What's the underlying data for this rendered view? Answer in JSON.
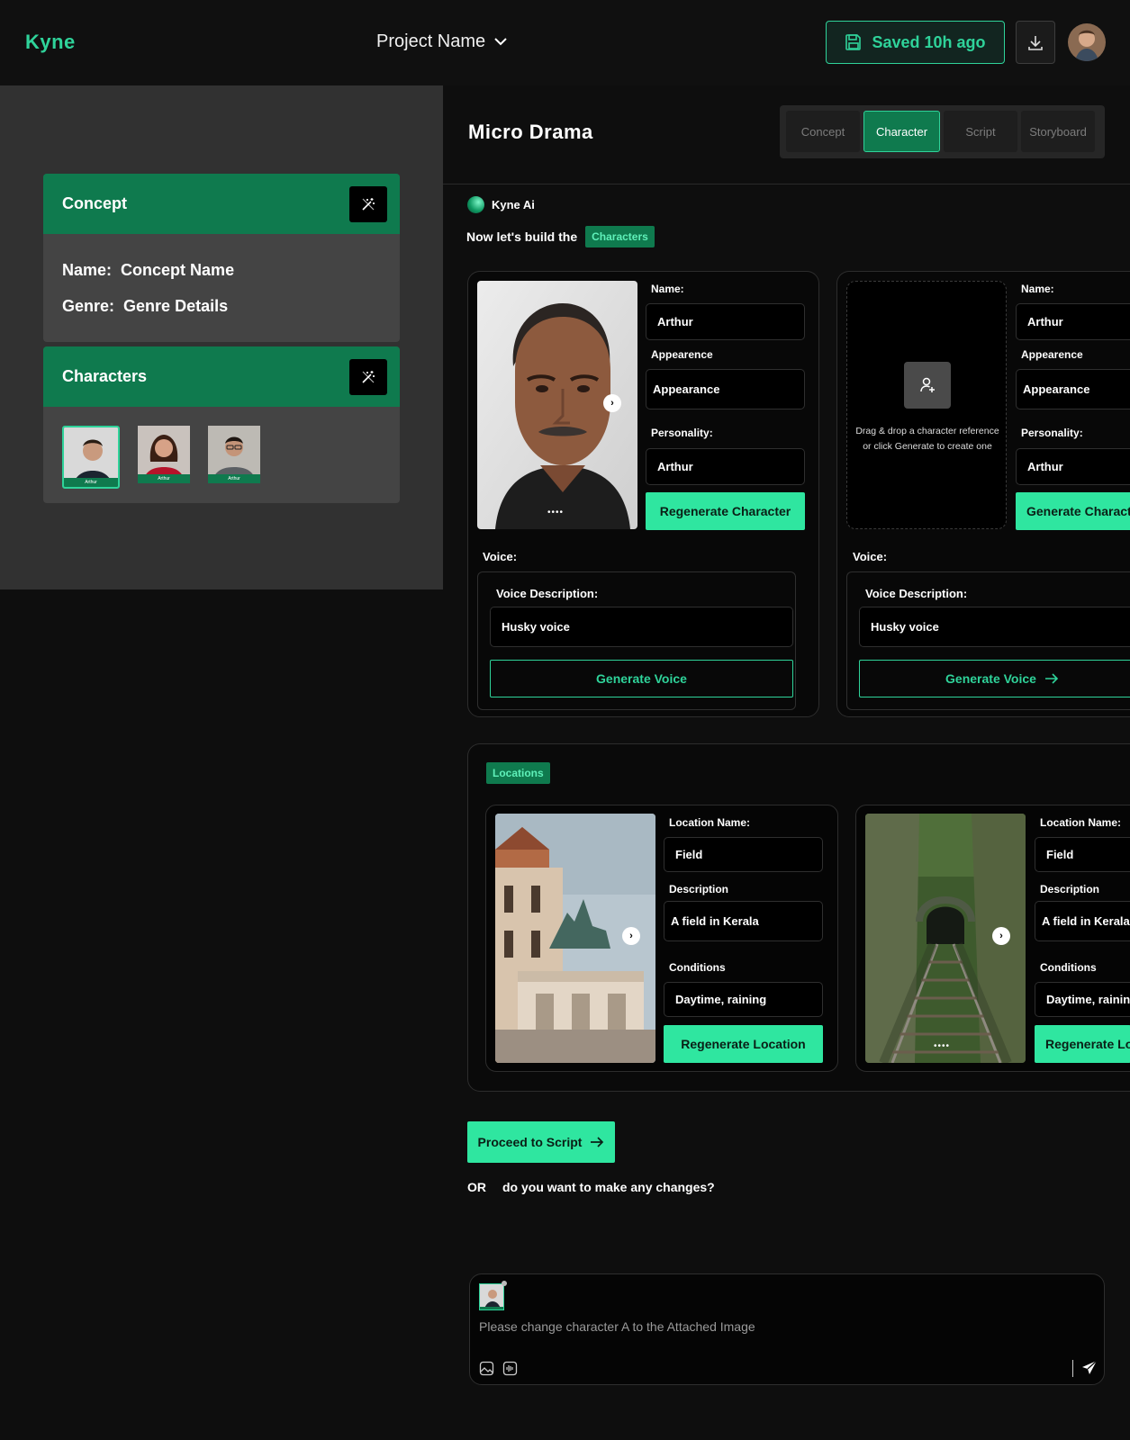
{
  "header": {
    "logo": "Kyne",
    "project_name": "Project Name",
    "saved_status": "Saved 10h ago"
  },
  "sidebar": {
    "concept_card": {
      "title": "Concept",
      "name_label": "Name:",
      "name_value": "Concept Name",
      "genre_label": "Genre:",
      "genre_value": "Genre Details"
    },
    "characters_card": {
      "title": "Characters",
      "thumb_labels": [
        "Arthur",
        "Arthur",
        "Arthur"
      ]
    }
  },
  "main": {
    "title": "Micro Drama",
    "tabs": [
      {
        "label": "Concept",
        "active": false
      },
      {
        "label": "Character",
        "active": true
      },
      {
        "label": "Script",
        "active": false
      },
      {
        "label": "Storyboard",
        "active": false
      }
    ],
    "assistant_name": "Kyne Ai",
    "build_text": "Now let's build the",
    "build_chip": "Characters"
  },
  "characters": [
    {
      "name_label": "Name:",
      "name_value": "Arthur",
      "appearance_label": "Appearence",
      "appearance_value": "Appearance",
      "personality_label": "Personality:",
      "personality_value": "Arthur",
      "action": "Regenerate Character",
      "voice_label": "Voice:",
      "voice_desc_label": "Voice Description:",
      "voice_desc_value": "Husky voice",
      "voice_action": "Generate Voice"
    },
    {
      "drop_text": "Drag & drop a character reference or click Generate to create one",
      "name_label": "Name:",
      "name_value": "Arthur",
      "appearance_label": "Appearence",
      "appearance_value": "Appearance",
      "personality_label": "Personality:",
      "personality_value": "Arthur",
      "action": "Generate Charact",
      "voice_label": "Voice:",
      "voice_desc_label": "Voice Description:",
      "voice_desc_value": "Husky voice",
      "voice_action": "Generate Voice"
    }
  ],
  "locations": {
    "chip": "Locations",
    "items": [
      {
        "name_label": "Location Name:",
        "name_value": "Field",
        "desc_label": "Description",
        "desc_value": "A field in Kerala",
        "cond_label": "Conditions",
        "cond_value": "Daytime, raining",
        "action": "Regenerate Location"
      },
      {
        "name_label": "Location Name:",
        "name_value": "Field",
        "desc_label": "Description",
        "desc_value": "A field in Kerala",
        "cond_label": "Conditions",
        "cond_value": "Daytime, rainin",
        "action": "Regenerate Lo"
      }
    ]
  },
  "proceed": {
    "label": "Proceed to Script",
    "or": "OR",
    "question": "do you want to make any changes?"
  },
  "chat": {
    "placeholder": "Please change character A to the Attached Image"
  },
  "colors": {
    "accent": "#2fe6a0",
    "brand_green": "#0f7a4e",
    "background": "#0e0e0e"
  }
}
